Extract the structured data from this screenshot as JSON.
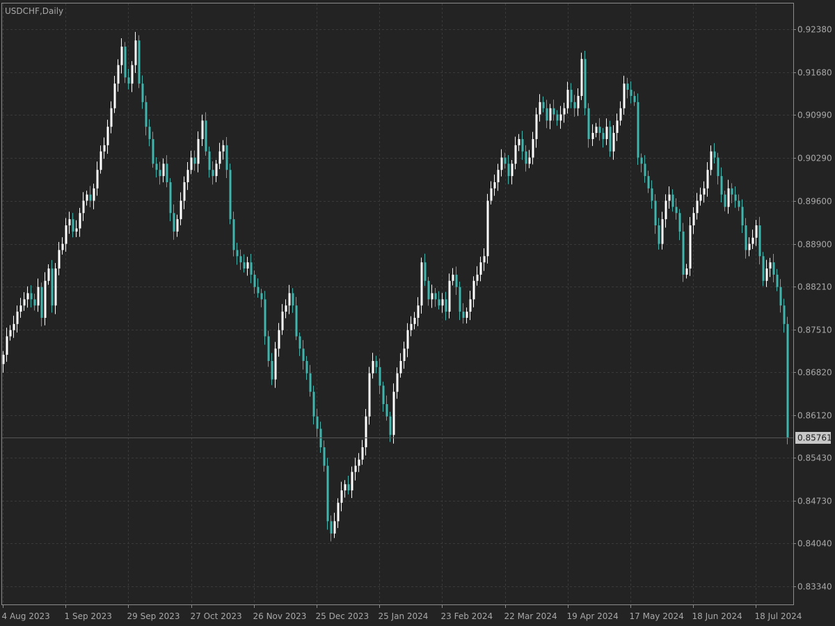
{
  "colors": {
    "background": "#232323",
    "grid": "#3a3a3a",
    "frame": "#8c8c8c",
    "axis_text": "#a8a8a8",
    "bull": "#ffffff",
    "bear": "#3fb5ad",
    "current_price_line": "#555555",
    "current_price_tag_bg": "#c8c8c8"
  },
  "chart_data": {
    "type": "candlestick",
    "symbol_label": "USDCHF,Daily",
    "timeframe": "Daily",
    "grid": true,
    "ylim": [
      0.8305,
      0.928
    ],
    "y_ticks": [
      "0.92380",
      "0.91680",
      "0.90990",
      "0.90290",
      "0.89600",
      "0.88900",
      "0.88210",
      "0.87510",
      "0.86820",
      "0.86120",
      "0.85430",
      "0.84730",
      "0.84040",
      "0.83340"
    ],
    "x_ticks": [
      "4 Aug 2023",
      "1 Sep 2023",
      "29 Sep 2023",
      "27 Oct 2023",
      "26 Nov 2023",
      "25 Dec 2023",
      "25 Jan 2024",
      "23 Feb 2024",
      "22 Mar 2024",
      "19 Apr 2024",
      "17 May 2024",
      "18 Jun 2024",
      "18 Jul 2024"
    ],
    "current_price": "0.85761",
    "closes": [
      0.871,
      0.874,
      0.875,
      0.876,
      0.878,
      0.879,
      0.88,
      0.881,
      0.88,
      0.879,
      0.882,
      0.877,
      0.883,
      0.885,
      0.879,
      0.885,
      0.888,
      0.889,
      0.892,
      0.893,
      0.891,
      0.8915,
      0.894,
      0.896,
      0.897,
      0.896,
      0.898,
      0.901,
      0.904,
      0.905,
      0.908,
      0.911,
      0.915,
      0.918,
      0.921,
      0.916,
      0.915,
      0.918,
      0.922,
      0.915,
      0.912,
      0.908,
      0.906,
      0.902,
      0.901,
      0.9,
      0.902,
      0.899,
      0.894,
      0.891,
      0.893,
      0.896,
      0.899,
      0.901,
      0.903,
      0.902,
      0.906,
      0.909,
      0.904,
      0.901,
      0.9,
      0.902,
      0.904,
      0.905,
      0.901,
      0.893,
      0.888,
      0.887,
      0.886,
      0.885,
      0.886,
      0.884,
      0.882,
      0.881,
      0.88,
      0.874,
      0.87,
      0.867,
      0.872,
      0.875,
      0.878,
      0.879,
      0.881,
      0.879,
      0.874,
      0.872,
      0.87,
      0.868,
      0.865,
      0.861,
      0.859,
      0.856,
      0.853,
      0.844,
      0.842,
      0.844,
      0.847,
      0.849,
      0.85,
      0.849,
      0.852,
      0.853,
      0.854,
      0.856,
      0.861,
      0.868,
      0.87,
      0.869,
      0.866,
      0.863,
      0.861,
      0.858,
      0.865,
      0.868,
      0.87,
      0.872,
      0.875,
      0.876,
      0.877,
      0.879,
      0.886,
      0.883,
      0.88,
      0.881,
      0.88,
      0.879,
      0.88,
      0.878,
      0.883,
      0.884,
      0.882,
      0.878,
      0.877,
      0.878,
      0.88,
      0.883,
      0.884,
      0.886,
      0.887,
      0.896,
      0.898,
      0.899,
      0.901,
      0.903,
      0.902,
      0.9,
      0.902,
      0.905,
      0.906,
      0.904,
      0.902,
      0.903,
      0.906,
      0.91,
      0.912,
      0.911,
      0.909,
      0.911,
      0.91,
      0.909,
      0.91,
      0.911,
      0.914,
      0.912,
      0.911,
      0.913,
      0.919,
      0.911,
      0.906,
      0.907,
      0.908,
      0.907,
      0.906,
      0.908,
      0.904,
      0.907,
      0.909,
      0.911,
      0.915,
      0.914,
      0.913,
      0.912,
      0.903,
      0.902,
      0.9,
      0.898,
      0.896,
      0.892,
      0.889,
      0.893,
      0.896,
      0.897,
      0.895,
      0.894,
      0.891,
      0.884,
      0.885,
      0.892,
      0.894,
      0.896,
      0.897,
      0.898,
      0.901,
      0.904,
      0.903,
      0.9,
      0.897,
      0.895,
      0.898,
      0.897,
      0.896,
      0.895,
      0.892,
      0.888,
      0.889,
      0.89,
      0.892,
      0.887,
      0.883,
      0.885,
      0.886,
      0.884,
      0.882,
      0.879,
      0.876,
      0.8576
    ]
  }
}
